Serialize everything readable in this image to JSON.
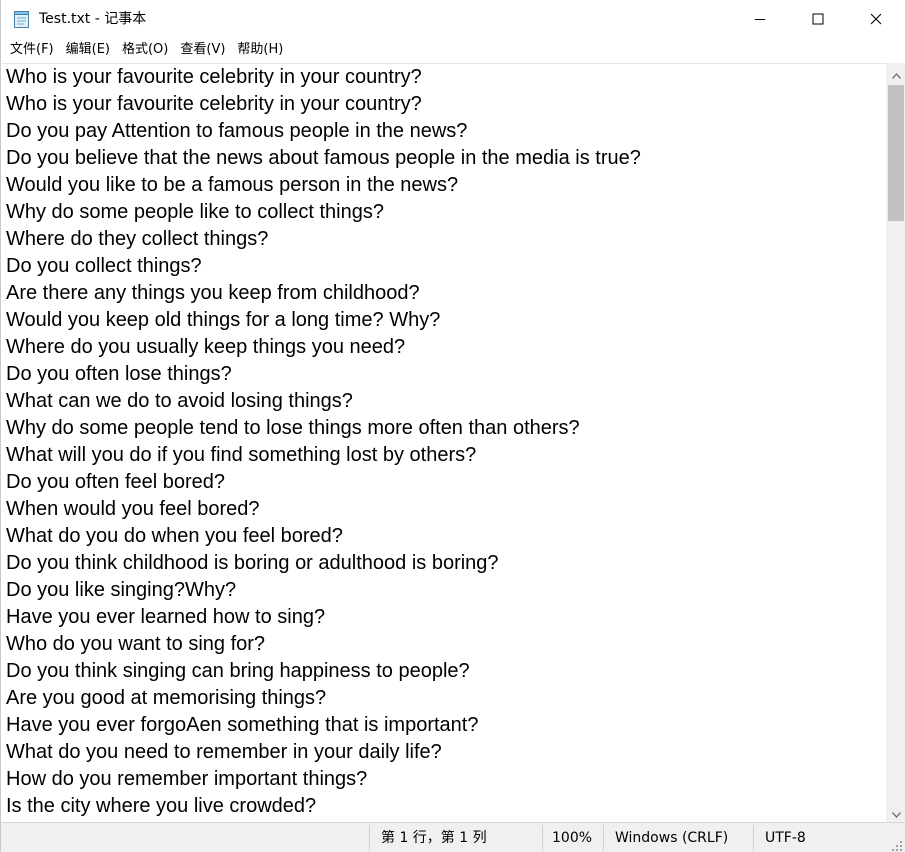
{
  "window": {
    "title": "Test.txt - 记事本",
    "app_icon": "notepad-icon",
    "controls": {
      "minimize": "minimize-icon",
      "maximize": "maximize-icon",
      "close": "close-icon"
    }
  },
  "menu": [
    {
      "label": "文件(F)"
    },
    {
      "label": "编辑(E)"
    },
    {
      "label": "格式(O)"
    },
    {
      "label": "查看(V)"
    },
    {
      "label": "帮助(H)"
    }
  ],
  "document": {
    "lines": [
      "Who is your favourite celebrity in your country?",
      "Who is your favourite celebrity in your country?",
      "Do you pay Attention to famous people in the news?",
      "Do you believe that the news about famous people in the media is true?",
      "Would you like to be a famous person in the news?",
      "Why do some people like to collect things?",
      "Where do they collect things?",
      "Do you collect things?",
      "Are there any things you keep from childhood?",
      "Would you keep old things for a long time? Why?",
      "Where do you usually keep things you need?",
      "Do you often lose things?",
      "What can we do to avoid losing things?",
      "Why do some people tend to lose things more often than others?",
      "What will you do if you find something lost by others?",
      "Do you often feel bored?",
      "When would you feel bored?",
      "What do you do when you feel bored?",
      "Do you think childhood is boring or adulthood is boring?",
      "Do you like singing?Why?",
      "Have you ever learned how to sing?",
      "Who do you want to sing for?",
      "Do you think singing can bring happiness to people?",
      "Are you good at memorising things?",
      "Have you ever forgoAen something that is important?",
      "What do you need to remember in your daily life?",
      "How do you remember important things?",
      "Is the city where you live crowded?"
    ]
  },
  "status": {
    "position": "第 1 行，第 1 列",
    "zoom": "100%",
    "line_ending": "Windows (CRLF)",
    "encoding": "UTF-8"
  },
  "scrollbar": {
    "position_fraction": 0.0,
    "visible_fraction": 0.19
  }
}
